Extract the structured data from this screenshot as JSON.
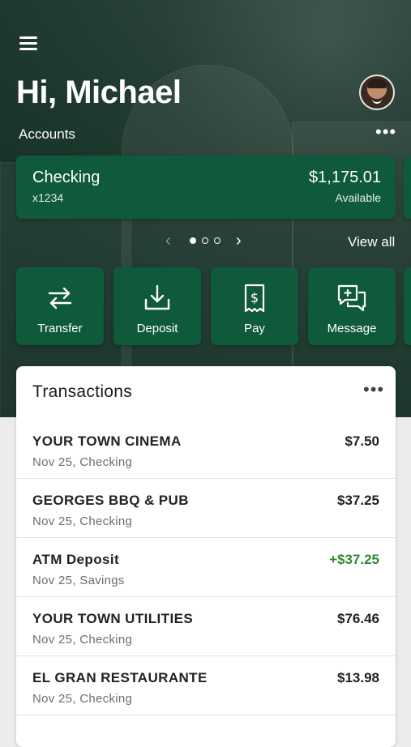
{
  "header": {
    "greeting": "Hi, Michael"
  },
  "accounts": {
    "label": "Accounts",
    "cards": [
      {
        "name": "Checking",
        "number": "x1234",
        "balance": "$1,175.01",
        "balance_label": "Available"
      }
    ],
    "view_all": "View all",
    "pager": {
      "total": 3,
      "active": 1
    }
  },
  "actions": [
    {
      "label": "Transfer",
      "icon": "transfer-icon"
    },
    {
      "label": "Deposit",
      "icon": "deposit-icon"
    },
    {
      "label": "Pay",
      "icon": "bill-pay-icon"
    },
    {
      "label": "Message",
      "icon": "message-icon"
    }
  ],
  "transactions": {
    "title": "Transactions",
    "items": [
      {
        "name": "YOUR TOWN CINEMA",
        "meta": "Nov 25, Checking",
        "amount": "$7.50",
        "credit": false
      },
      {
        "name": "GEORGES BBQ & PUB",
        "meta": "Nov 25, Checking",
        "amount": "$37.25",
        "credit": false
      },
      {
        "name": "ATM Deposit",
        "meta": "Nov 25, Savings",
        "amount": "+$37.25",
        "credit": true
      },
      {
        "name": "YOUR TOWN UTILITIES",
        "meta": "Nov 25, Checking",
        "amount": "$76.46",
        "credit": false
      },
      {
        "name": "EL GRAN RESTAURANTE",
        "meta": "Nov 25, Checking",
        "amount": "$13.98",
        "credit": false
      }
    ]
  },
  "colors": {
    "brand_green": "#0f5a3a",
    "credit_green": "#2f8a2f"
  }
}
